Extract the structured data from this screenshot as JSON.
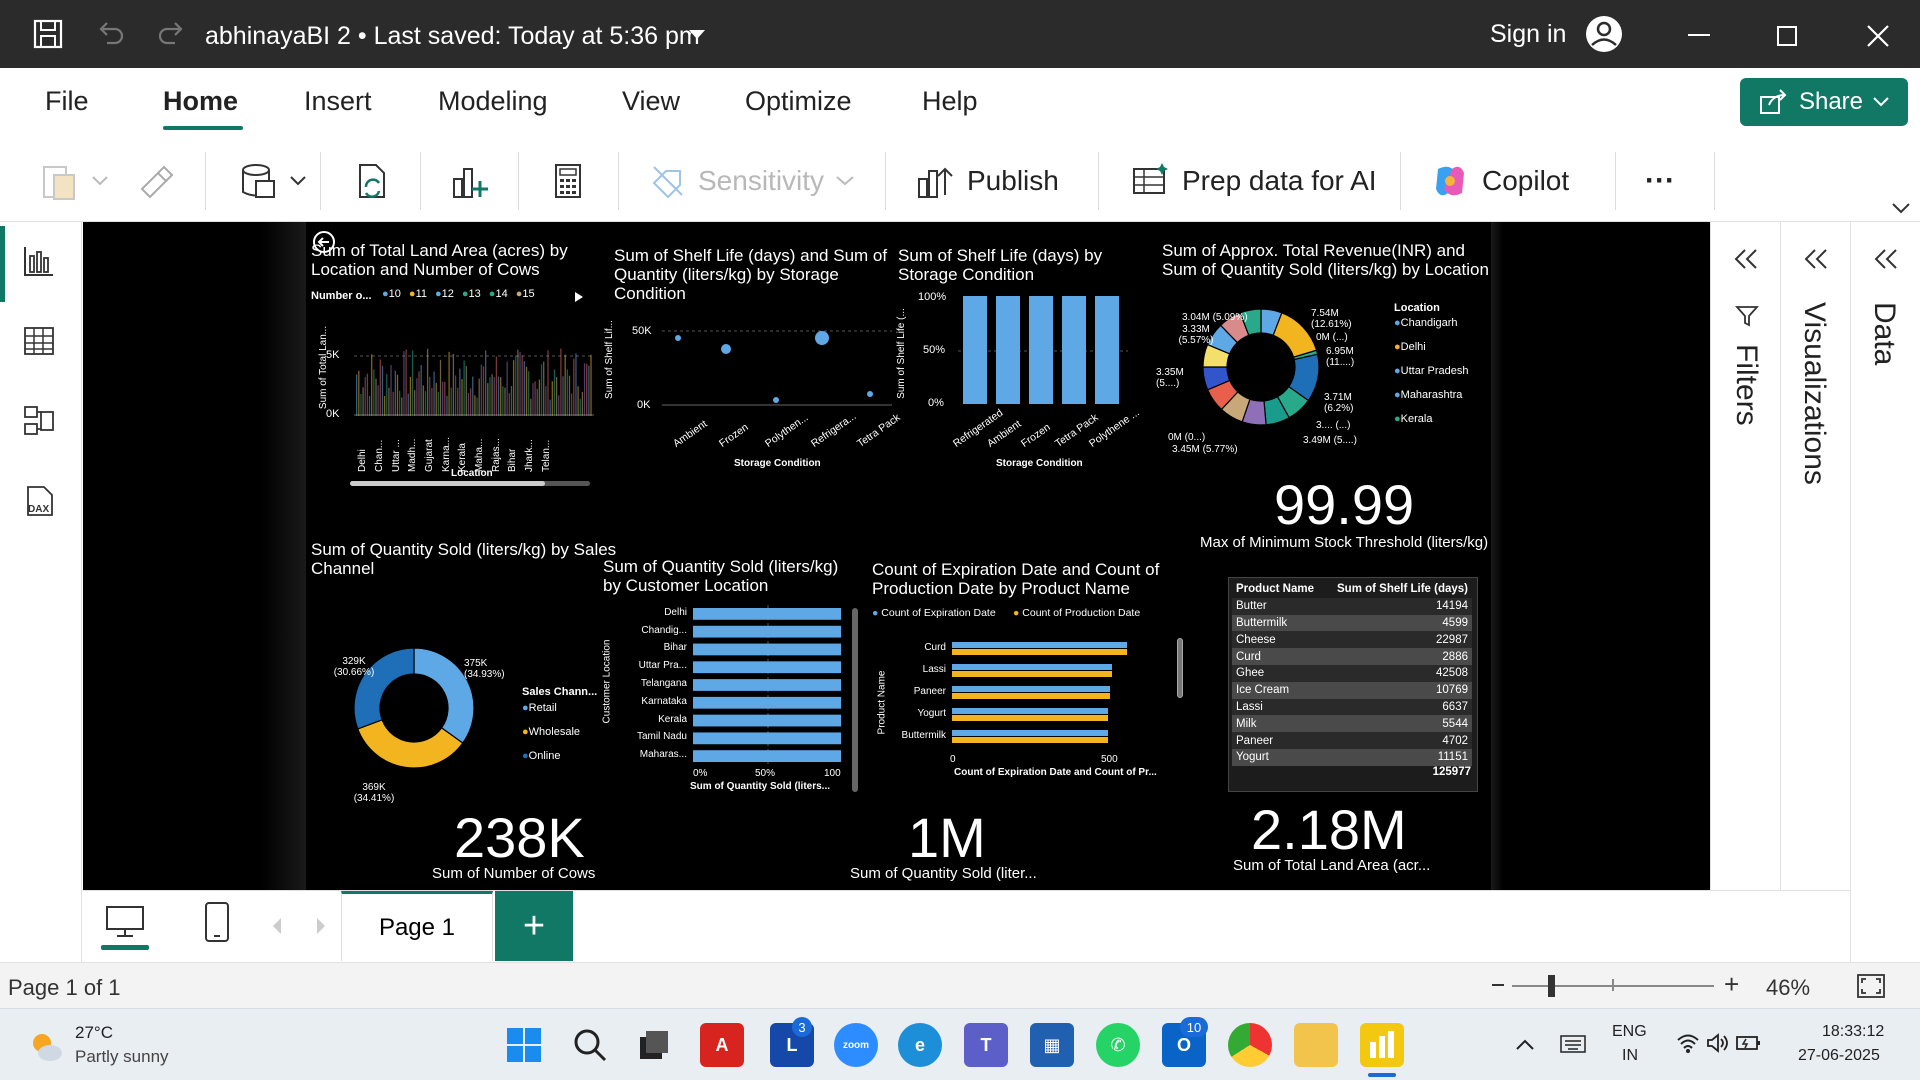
{
  "titlebar": {
    "doc_title": "abhinayaBI 2  •  Last saved: Today at 5:36 pm",
    "sign_in": "Sign in"
  },
  "ribbon_tabs": [
    "File",
    "Home",
    "Insert",
    "Modeling",
    "View",
    "Optimize",
    "Help"
  ],
  "share_label": "Share",
  "ribbon": {
    "sensitivity": "Sensitivity",
    "publish": "Publish",
    "prep_data": "Prep data for AI",
    "copilot": "Copilot",
    "more": "···"
  },
  "panes": {
    "filters": "Filters",
    "visualizations": "Visualizations",
    "data": "Data"
  },
  "pages": {
    "tab": "Page 1",
    "add": "+"
  },
  "status": {
    "page_of": "Page 1 of 1",
    "zoom": "46%"
  },
  "taskbar": {
    "weather_temp": "27°C",
    "weather_desc": "Partly sunny",
    "lang": "ENG",
    "region": "IN",
    "time": "18:33:12",
    "date": "27-06-2025",
    "badge_l": "3",
    "badge_outlook": "10"
  },
  "colors": {
    "accent": "#117865",
    "bar_blue": "#5ea8e6",
    "bar_yellow": "#f2b51f",
    "bar_blue_dark": "#1f6fb8"
  },
  "visuals": {
    "land_area": {
      "title": "Sum of Total Land Area (acres) by Location and Number of Cows",
      "legend_title": "Number o...",
      "legend": [
        "10",
        "11",
        "12",
        "13",
        "14",
        "15"
      ],
      "ylabel": "Sum of Total Lan...",
      "xlabel": "Location",
      "yticks": [
        "5K",
        "0K"
      ],
      "categories": [
        "Delhi",
        "Chan...",
        "Uttar ...",
        "Madh...",
        "Gujarat",
        "Karna...",
        "Kerala",
        "Maha...",
        "Rajas...",
        "Bihar",
        "Jhark...",
        "Telan..."
      ]
    },
    "shelf_qty": {
      "title": "Sum of Shelf Life (days) and Sum of Quantity (liters/kg) by Storage Condition",
      "ylabel": "Sum of Shelf Lif...",
      "xlabel": "Storage Condition",
      "yticks": [
        "50K",
        "0K"
      ],
      "categories": [
        "Ambient",
        "Frozen",
        "Polythen...",
        "Refrigera...",
        "Tetra Pack"
      ]
    },
    "shelf_storage": {
      "title": "Sum of Shelf Life (days) by Storage Condition",
      "ylabel": "Sum of Shelf Life (...",
      "xlabel": "Storage Condition",
      "yticks": [
        "100%",
        "50%",
        "0%"
      ],
      "categories": [
        "Refrigerated",
        "Ambient",
        "Frozen",
        "Tetra Pack",
        "Polythene ..."
      ]
    },
    "revenue_donut": {
      "title": "Sum of Approx. Total Revenue(INR) and Sum of Quantity Sold (liters/kg) by Location",
      "legend_title": "Location",
      "legend": [
        "Chandigarh",
        "Delhi",
        "Uttar Pradesh",
        "Maharashtra",
        "Kerala"
      ],
      "labels": [
        "3.04M (5.09%)",
        "3.33M (5.57%)",
        "7.54M (12.61%)",
        "0M (...)",
        "6.95M (11....)",
        "3.35M (5....)",
        "3.71M (6.2%)",
        "3.... (...)",
        "3.49M (5....)",
        "0M (0...)",
        "3.45M (5.77%)"
      ]
    },
    "kpi_stock": {
      "value": "99.99",
      "label": "Max of Minimum Stock Threshold (liters/kg)"
    },
    "sales_channel": {
      "title": "Sum of Quantity Sold (liters/kg) by Sales Channel",
      "legend_title": "Sales Chann...",
      "legend": [
        "Retail",
        "Wholesale",
        "Online"
      ],
      "labels": [
        "329K (30.66%)",
        "375K (34.93%)",
        "369K (34.41%)"
      ]
    },
    "qty_location": {
      "title": "Sum of Quantity Sold (liters/kg) by Customer Location",
      "ylabel": "Customer Location",
      "xlabel": "Sum of Quantity Sold (liters...",
      "categories": [
        "Delhi",
        "Chandig...",
        "Bihar",
        "Uttar Pra...",
        "Telangana",
        "Karnataka",
        "Kerala",
        "Tamil Nadu",
        "Maharas..."
      ],
      "xticks": [
        "0%",
        "50%",
        "100"
      ]
    },
    "expiration": {
      "title": "Count of Expiration Date and Count of Production Date by Product Name",
      "legend": [
        "Count of Expiration Date",
        "Count of Production Date"
      ],
      "ylabel": "Product Name",
      "xlabel": "Count of Expiration Date and Count of Pr...",
      "categories": [
        "Curd",
        "Lassi",
        "Paneer",
        "Yogurt",
        "Buttermilk"
      ],
      "xticks": [
        "0",
        "500"
      ]
    },
    "product_table": {
      "headers": [
        "Product Name",
        "Sum of Shelf Life (days)"
      ],
      "rows": [
        [
          "Butter",
          "14194"
        ],
        [
          "Buttermilk",
          "4599"
        ],
        [
          "Cheese",
          "22987"
        ],
        [
          "Curd",
          "2886"
        ],
        [
          "Ghee",
          "42508"
        ],
        [
          "Ice Cream",
          "10769"
        ],
        [
          "Lassi",
          "6637"
        ],
        [
          "Milk",
          "5544"
        ],
        [
          "Paneer",
          "4702"
        ],
        [
          "Yogurt",
          "11151"
        ]
      ],
      "total": "125977"
    },
    "kpi_cows": {
      "value": "238K",
      "label": "Sum of Number of Cows"
    },
    "kpi_qty": {
      "value": "1M",
      "label": "Sum of Quantity Sold (liter..."
    },
    "kpi_land": {
      "value": "2.18M",
      "label": "Sum of Total Land Area (acr..."
    }
  }
}
